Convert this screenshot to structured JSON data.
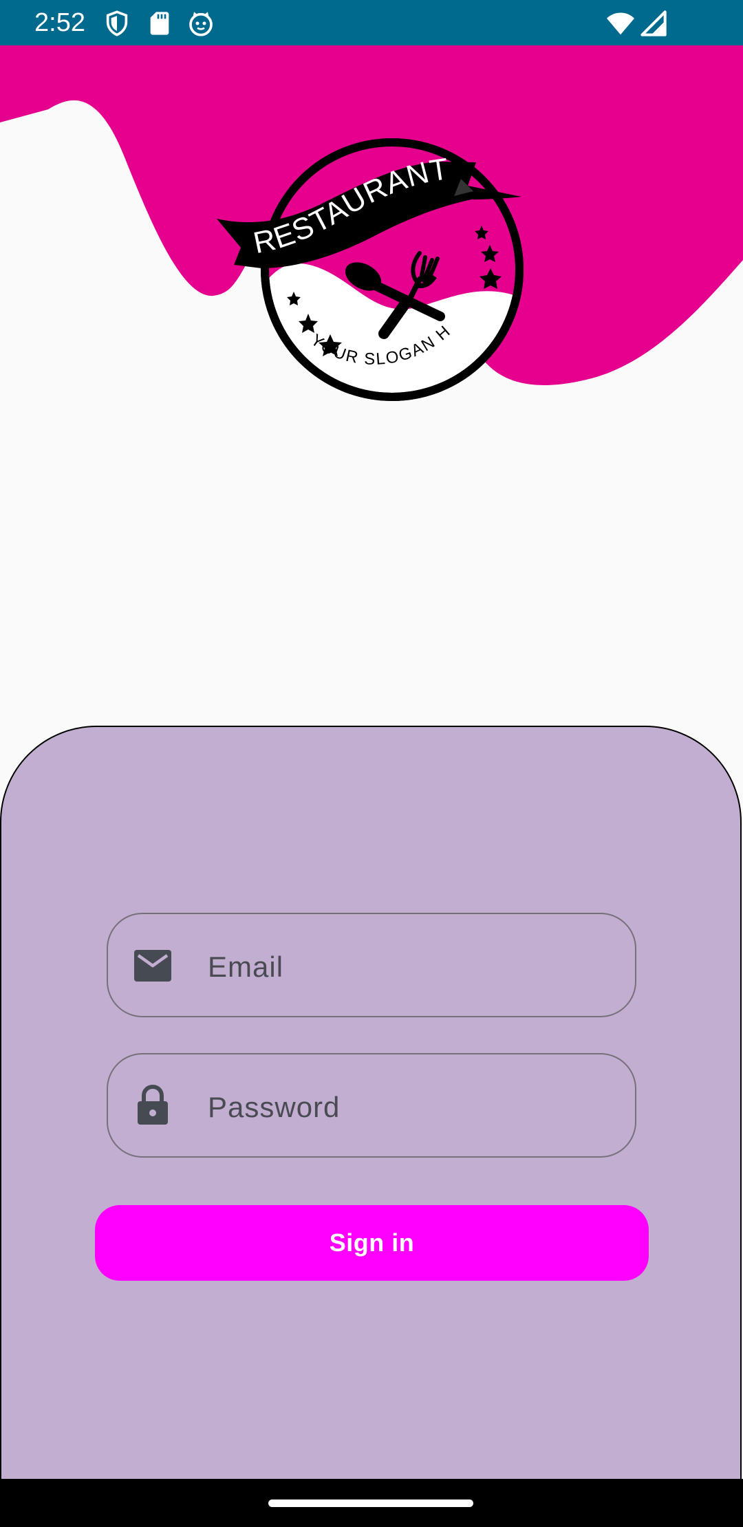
{
  "status_bar": {
    "time": "2:52",
    "left_icons": [
      "shield-icon",
      "sd-card-icon",
      "cat-face-icon"
    ],
    "right_icons": [
      "wifi-icon",
      "cell-signal-icon"
    ],
    "background": "#006a8e"
  },
  "header": {
    "wave_color": "#e5008e",
    "logo": {
      "ribbon_text": "RESTAURANT",
      "slogan_text": "YOUR SLOGAN HERE"
    }
  },
  "login": {
    "card_color": "#c2aed1",
    "email": {
      "placeholder": "Email",
      "value": "",
      "icon": "mail-icon"
    },
    "password": {
      "placeholder": "Password",
      "value": "",
      "icon": "lock-icon"
    },
    "signin_label": "Sign in",
    "button_color": "#ff00ff"
  },
  "nav_bar": {
    "handle": "gesture-handle"
  }
}
